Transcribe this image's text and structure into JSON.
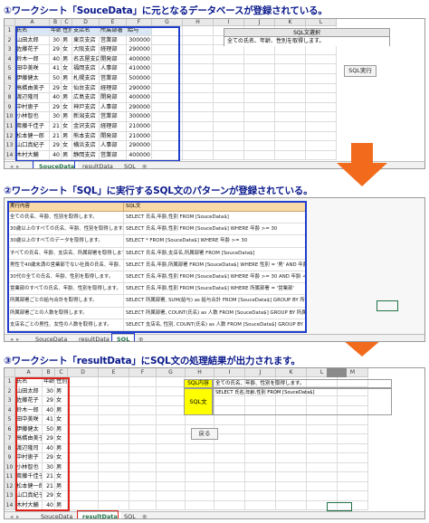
{
  "captions": {
    "step1": "①ワークシート「SouceData」に元となるデータベースが登録されている。",
    "step2": "②ワークシート「SQL」に実行するSQL文のパターンが登録されている。",
    "step3": "③ワークシート「resultData」にSQL文の処理結果が出力されます。"
  },
  "columns1": [
    "A",
    "B",
    "C",
    "D",
    "E",
    "F",
    "G",
    "H",
    "I",
    "J",
    "K",
    "L"
  ],
  "headers1": [
    "氏名",
    "年齢",
    "性別",
    "支店名",
    "所属部署",
    "給与"
  ],
  "rows": [
    [
      "山田太郎",
      "30",
      "男",
      "東京支店",
      "営業部",
      "300000"
    ],
    [
      "佐藤花子",
      "29",
      "女",
      "大阪支店",
      "経理部",
      "290000"
    ],
    [
      "鈴木一郎",
      "40",
      "男",
      "名古屋支店",
      "開発部",
      "400000"
    ],
    [
      "田中美咲",
      "41",
      "女",
      "福岡支店",
      "人事部",
      "410000"
    ],
    [
      "伊藤健太",
      "50",
      "男",
      "札幌支店",
      "営業部",
      "500000"
    ],
    [
      "高橋由美子",
      "29",
      "女",
      "仙台支店",
      "経理部",
      "290000"
    ],
    [
      "渡辺隆司",
      "40",
      "男",
      "広島支店",
      "開発部",
      "400000"
    ],
    [
      "中村恵子",
      "29",
      "女",
      "神戸支店",
      "人事部",
      "290000"
    ],
    [
      "小林智也",
      "30",
      "男",
      "新潟支店",
      "営業部",
      "300000"
    ],
    [
      "斎藤千佳子",
      "21",
      "女",
      "金沢支店",
      "経理部",
      "210000"
    ],
    [
      "松本健一郎",
      "21",
      "男",
      "熊本支店",
      "開発部",
      "210000"
    ],
    [
      "山口真紀子",
      "29",
      "女",
      "横浜支店",
      "人事部",
      "290000"
    ],
    [
      "木村大輔",
      "40",
      "男",
      "静岡支店",
      "営業部",
      "400000"
    ]
  ],
  "panel1": {
    "title": "SQL文選択",
    "value": "全ての氏名、年齢、性別を取得します。",
    "button": "SQL実行"
  },
  "tabs1": [
    "SouceData",
    "resultData",
    "SQL"
  ],
  "sql_headers": [
    "実行内容",
    "SQL文"
  ],
  "sql_rows": [
    [
      "全ての氏名、年齢、性別を取得します。",
      "SELECT 氏名,年齢,性別 FROM [SouceData$]"
    ],
    [
      "30歳以上のすべての氏名、年齢、性別を取得します。",
      "SELECT 氏名,年齢,性別 FROM [SouceData$] WHERE 年齢 >= 30"
    ],
    [
      "30歳以上のすべてのデータを取得します。",
      "SELECT * FROM [SouceData$] WHERE 年齢 >= 30"
    ],
    [
      "すべての氏名、年齢、支店名、所属部署を取得します。",
      "SELECT 氏名,年齢,支店名,所属部署 FROM [SouceData$]"
    ],
    [
      "男性で40歳未満の営業部でない社員の氏名、年齢、所属部署を取得します。",
      "SELECT 氏名,年齢,所属部署 FROM [SouceData$] WHERE 性別 = '男' AND 年齢 < 40 AND 所属部署 <> '営業部'"
    ],
    [
      "30代の全ての氏名、年齢、性別を取得します。",
      "SELECT 氏名,年齢,性別 FROM [SouceData$] WHERE 年齢 >= 30 AND 年齢 < 40"
    ],
    [
      "営業部のすべての氏名、年齢、性別を取得します。",
      "SELECT 氏名,年齢,性別 FROM [SouceData$] WHERE 所属部署 = '営業部'"
    ],
    [
      "所属部署ごとの給与合計を取得します。",
      "SELECT 所属部署, SUM(給与) as 給与合計 FROM [SouceData$] GROUP BY 所属部署"
    ],
    [
      "所属部署ごとの人数を取得します。",
      "SELECT 所属部署, COUNT(氏名) as 人数 FROM [SouceData$] GROUP BY 所属部署"
    ],
    [
      "支店名ごとの男性、女性の人数を取得します。",
      "SELECT 支店名, 性別, COUNT(氏名) as 人数 FROM [SouceData$] GROUP BY 支店名,性別"
    ]
  ],
  "tabs2": [
    "SouceData",
    "resultData",
    "SQL"
  ],
  "columns3": [
    "A",
    "B",
    "C",
    "D",
    "E",
    "F",
    "G",
    "H",
    "I",
    "J",
    "K",
    "L",
    "M"
  ],
  "headers3": [
    "氏名",
    "年齢",
    "性別"
  ],
  "result_rows": [
    [
      "山田太郎",
      "30",
      "男"
    ],
    [
      "佐藤花子",
      "29",
      "女"
    ],
    [
      "鈴木一郎",
      "40",
      "男"
    ],
    [
      "田中美咲",
      "41",
      "女"
    ],
    [
      "伊藤健太",
      "50",
      "男"
    ],
    [
      "高橋由美子",
      "29",
      "女"
    ],
    [
      "渡辺隆司",
      "40",
      "男"
    ],
    [
      "中村恵子",
      "29",
      "女"
    ],
    [
      "小林智也",
      "30",
      "男"
    ],
    [
      "斎藤千佳子",
      "21",
      "女"
    ],
    [
      "松本健一郎",
      "21",
      "男"
    ],
    [
      "山口真紀子",
      "29",
      "女"
    ],
    [
      "木村大輔",
      "40",
      "男"
    ]
  ],
  "panel3": {
    "label1": "SQL内容",
    "value1": "全ての氏名、年齢、性別を取得します。",
    "label2": "SQL文",
    "value2": "SELECT 氏名,年齢,性別 FROM [SouceData$]",
    "button": "戻る"
  },
  "tabs3": [
    "SouceData",
    "resultData",
    "SQL"
  ],
  "colors": {
    "caption": "#0b1a8c",
    "arrow": "#f26b1d",
    "highlight_blue": "#1f3fcc",
    "highlight_red": "#e0241b",
    "label_yellow": "#ffff00"
  }
}
